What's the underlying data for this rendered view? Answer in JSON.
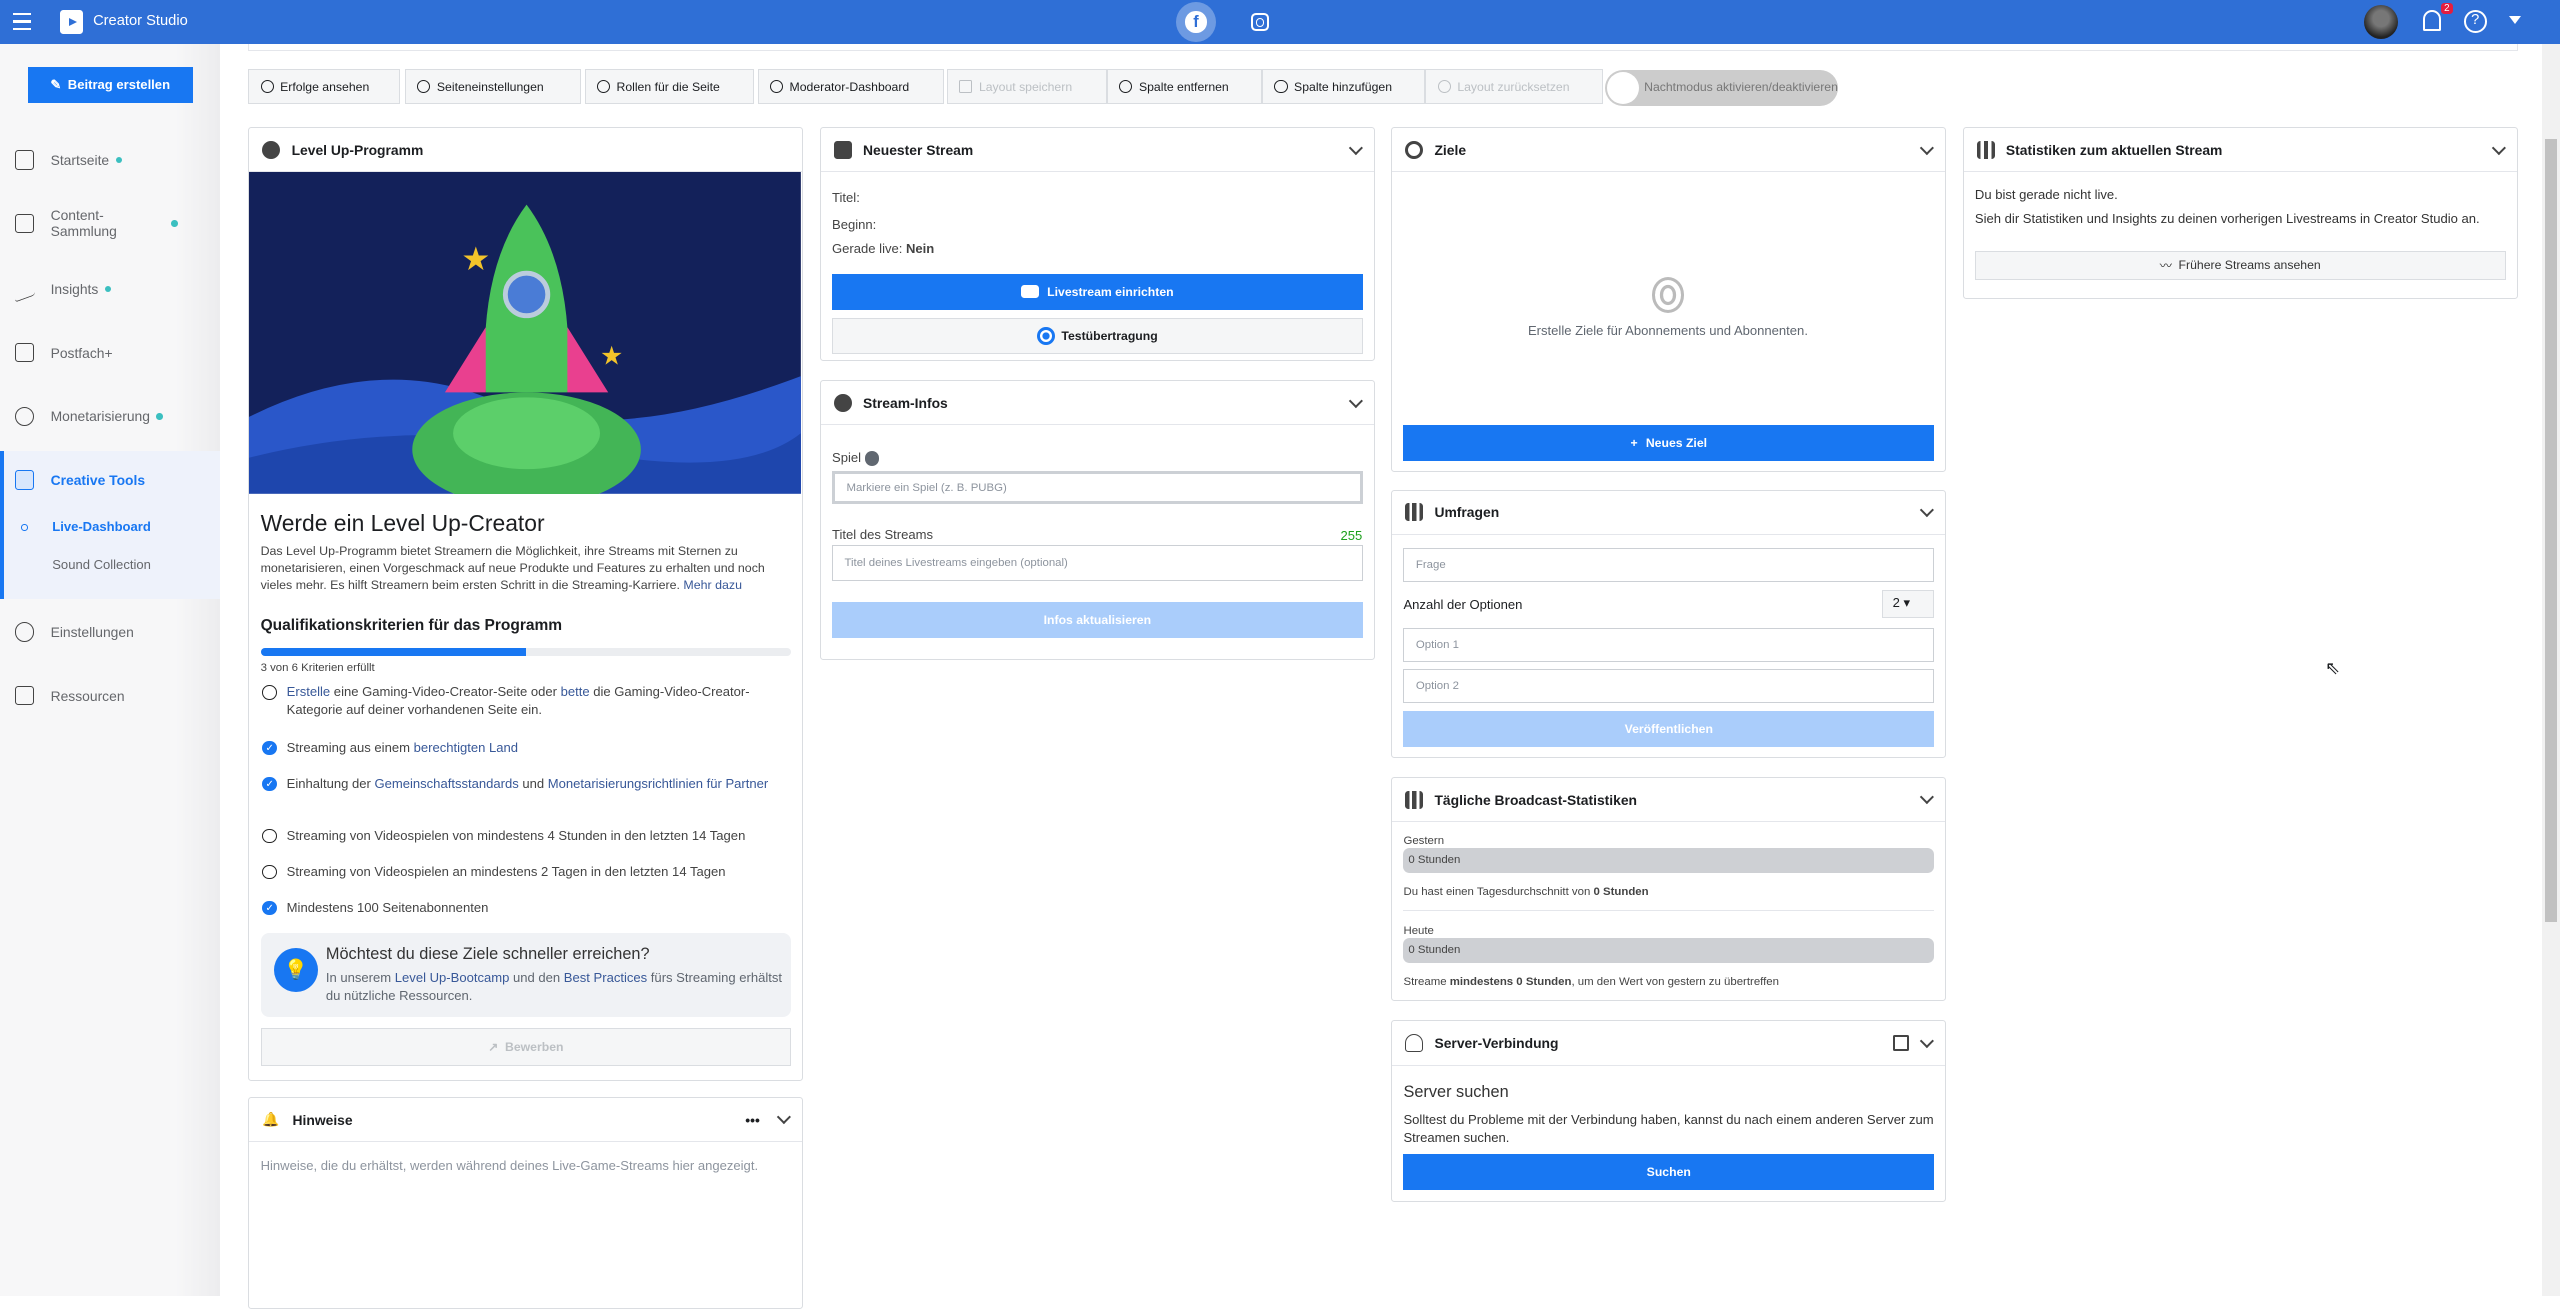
{
  "topbar": {
    "app_title": "Creator Studio",
    "notifications": "2",
    "help": "?"
  },
  "sidebar": {
    "create_post": "Beitrag erstellen",
    "items": [
      {
        "label": "Startseite"
      },
      {
        "label": "Content-Sammlung"
      },
      {
        "label": "Insights"
      },
      {
        "label": "Postfach+"
      },
      {
        "label": "Monetarisierung"
      },
      {
        "label": "Creative Tools"
      },
      {
        "label": "Einstellungen"
      },
      {
        "label": "Ressourcen"
      }
    ],
    "sub_items": [
      {
        "label": "Live-Dashboard"
      },
      {
        "label": "Sound Collection"
      }
    ]
  },
  "toolbar": {
    "buttons": [
      "Erfolge ansehen",
      "Seiteneinstellungen",
      "Rollen für die Seite",
      "Moderator-Dashboard",
      "Layout speichern",
      "Spalte entfernen",
      "Spalte hinzufügen",
      "Layout zurücksetzen"
    ],
    "night_mode": "Nachtmodus aktivieren/deaktivieren"
  },
  "levelup": {
    "header": "Level Up-Programm",
    "title": "Werde ein Level Up-Creator",
    "desc": "Das Level Up-Programm bietet Streamern die Möglichkeit, ihre Streams mit Sternen zu monetarisieren, einen Vorgeschmack auf neue Produkte und Features zu erhalten und noch vieles mehr. Es hilft Streamern beim ersten Schritt in die Streaming-Karriere.",
    "more": "Mehr dazu",
    "criteria_title": "Qualifikationskriterien für das Programm",
    "progress": 0.5,
    "progress_text": "3 von 6 Kriterien erfüllt",
    "criteria": [
      {
        "done": false,
        "parts": [
          "Erstelle",
          " eine Gaming-Video-Creator-Seite oder ",
          "bette",
          " die Gaming-Video-Creator-Kategorie auf deiner vorhandenen Seite ein."
        ]
      },
      {
        "done": true,
        "parts": [
          "Streaming aus einem ",
          "berechtigten Land"
        ]
      },
      {
        "done": true,
        "parts": [
          "Einhaltung der ",
          "Gemeinschaftsstandards",
          " und ",
          "Monetarisierungsrichtlinien für Partner"
        ]
      },
      {
        "done": false,
        "parts": [
          "Streaming von Videospielen von mindestens 4 Stunden in den letzten 14 Tagen"
        ]
      },
      {
        "done": false,
        "parts": [
          "Streaming von Videospielen an mindestens 2 Tagen in den letzten 14 Tagen"
        ]
      },
      {
        "done": true,
        "parts": [
          "Mindestens 100 Seitenabonnenten"
        ]
      }
    ],
    "tip_title": "Möchtest du diese Ziele schneller erreichen?",
    "tip_parts": [
      "In unserem ",
      "Level Up-Bootcamp",
      " und den ",
      "Best Practices",
      " fürs Streaming erhältst du nützliche Ressourcen."
    ],
    "apply": "Bewerben"
  },
  "hints": {
    "header": "Hinweise",
    "text": "Hinweise, die du erhältst, werden während deines Live-Game-Streams hier angezeigt."
  },
  "latest": {
    "header": "Neuester Stream",
    "title_label": "Titel:",
    "start_label": "Beginn:",
    "live_label": "Gerade live:",
    "live_value": "Nein",
    "setup": "Livestream einrichten",
    "test": "Testübertragung"
  },
  "info": {
    "header": "Stream-Infos",
    "game_label": "Spiel",
    "game_placeholder": "Markiere ein Spiel (z. B. PUBG)",
    "title_label": "Titel des Streams",
    "counter": "255",
    "title_placeholder": "Titel deines Livestreams eingeben (optional)",
    "update": "Infos aktualisieren"
  },
  "goals": {
    "header": "Ziele",
    "empty": "Erstelle Ziele für Abonnements und Abonnenten.",
    "new": "Neues Ziel"
  },
  "polls": {
    "header": "Umfragen",
    "question": "Frage",
    "count_label": "Anzahl der Optionen",
    "count": "2",
    "option1": "Option 1",
    "option2": "Option 2",
    "publish": "Veröffentlichen"
  },
  "daily": {
    "header": "Tägliche Broadcast-Statistiken",
    "yesterday": "Gestern",
    "yesterday_value": "0 Stunden",
    "avg_pre": "Du hast einen Tagesdurchschnitt von ",
    "avg_val": "0 Stunden",
    "today": "Heute",
    "today_value": "0 Stunden",
    "beat_pre": "Streame ",
    "beat_val": "mindestens 0 Stunden",
    "beat_post": ", um den Wert von gestern zu übertreffen"
  },
  "server": {
    "header": "Server-Verbindung",
    "title": "Server suchen",
    "text": "Solltest du Probleme mit der Verbindung haben, kannst du nach einem anderen Server zum Streamen suchen.",
    "button": "Suchen"
  },
  "stats": {
    "header": "Statistiken zum aktuellen Stream",
    "not_live": "Du bist gerade nicht live.",
    "text": "Sieh dir Statistiken und Insights zu deinen vorherigen Livestreams in Creator Studio an.",
    "button": "Frühere Streams ansehen"
  }
}
